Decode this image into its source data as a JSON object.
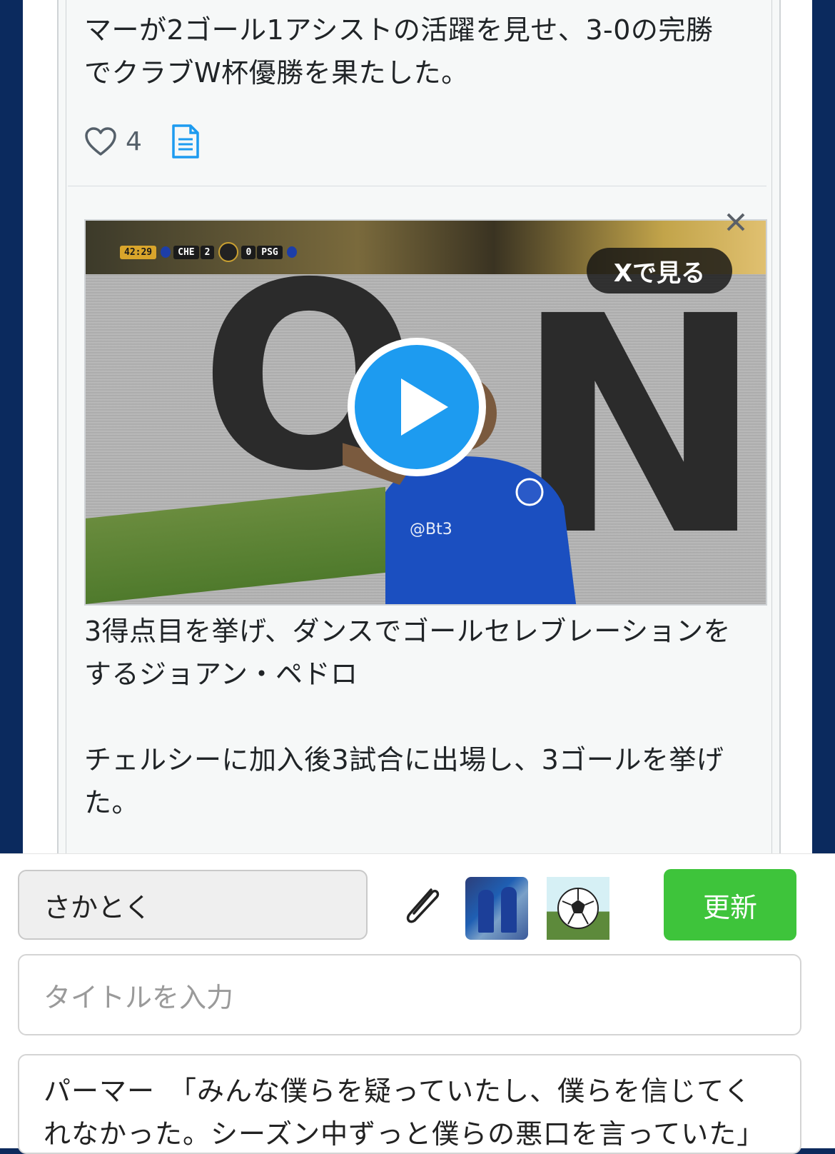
{
  "tweet1": {
    "text": "マーが2ゴール1アシストの活躍を見せ、3-0の完勝\nでクラブW杯優勝を果たした。",
    "like_count": "4",
    "icons": [
      "heart-icon",
      "document-icon"
    ]
  },
  "video": {
    "scorebug": {
      "time": "42:29",
      "home": "CHE",
      "home_score": "2",
      "away_score": "0",
      "away": "PSG"
    },
    "watch_on_x_label": "Xで見る",
    "watermark": "@Bt3",
    "icons": [
      "play-icon",
      "close-icon"
    ]
  },
  "tweet2": {
    "text": "3得点目を挙げ、ダンスでゴールセレブレーションを\nするジョアン・ペドロ\n\nチェルシーに加入後3試合に出場し、3ゴールを挙げ\nた。"
  },
  "compose": {
    "name_value": "さかとく",
    "update_label": "更新",
    "title_placeholder": "タイトルを入力",
    "body_value": "パーマー　「みんな僕らを疑っていたし、僕らを信じてく\nれなかった。シーズン中ずっと僕らの悪口を言っていた」",
    "icons": [
      "paperclip-icon",
      "soccer-ball-icon"
    ]
  },
  "colors": {
    "page_background": "#0b2a5e",
    "accent_blue": "#1d9bf0",
    "update_green": "#3ec43b"
  }
}
